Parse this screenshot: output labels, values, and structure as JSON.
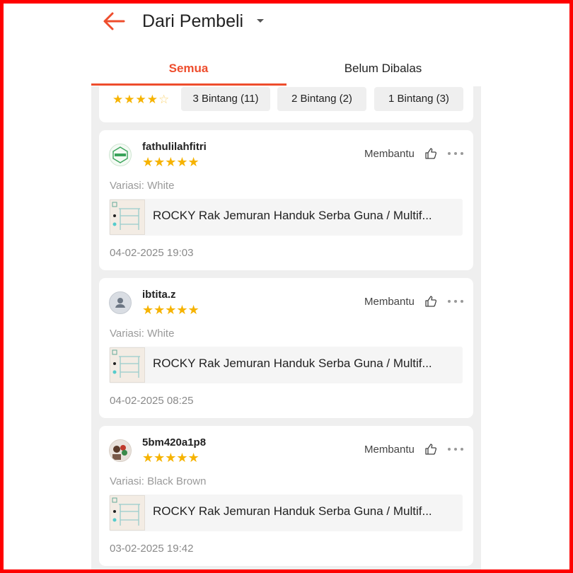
{
  "header": {
    "title": "Dari Pembeli",
    "tabs": [
      {
        "label": "Semua",
        "active": true
      },
      {
        "label": "Belum Dibalas",
        "active": false
      }
    ],
    "accent_color": "#ee4d2d"
  },
  "filter": {
    "stars_display": "★★★★",
    "star_empty": "☆",
    "chips": [
      {
        "label": "3 Bintang (11)"
      },
      {
        "label": "2 Bintang (2)"
      },
      {
        "label": "1 Bintang (3)"
      }
    ]
  },
  "reviews": [
    {
      "username": "fathulilahfitri",
      "rating": 5,
      "stars": "★★★★★",
      "helpful_label": "Membantu",
      "variation": "Variasi: White",
      "product_name": "ROCKY Rak Jemuran Handuk Serba Guna / Multif...",
      "timestamp": "04-02-2025 19:03",
      "avatar": "logo-avatar"
    },
    {
      "username": "ibtita.z",
      "rating": 5,
      "stars": "★★★★★",
      "helpful_label": "Membantu",
      "variation": "Variasi: White",
      "product_name": "ROCKY Rak Jemuran Handuk Serba Guna / Multif...",
      "timestamp": "04-02-2025 08:25",
      "avatar": "default-user-avatar"
    },
    {
      "username": "5bm420a1p8",
      "rating": 5,
      "stars": "★★★★★",
      "helpful_label": "Membantu",
      "variation": "Variasi: Black Brown",
      "product_name": "ROCKY Rak Jemuran Handuk Serba Guna / Multif...",
      "timestamp": "03-02-2025 19:42",
      "avatar": "photo-avatar"
    }
  ],
  "icons": {
    "back": "arrow-left-icon",
    "dropdown": "caret-down-icon",
    "helpful": "thumbs-up-icon",
    "more": "more-horizontal-icon"
  },
  "colors": {
    "star": "#f6b300",
    "background": "#efefef"
  }
}
